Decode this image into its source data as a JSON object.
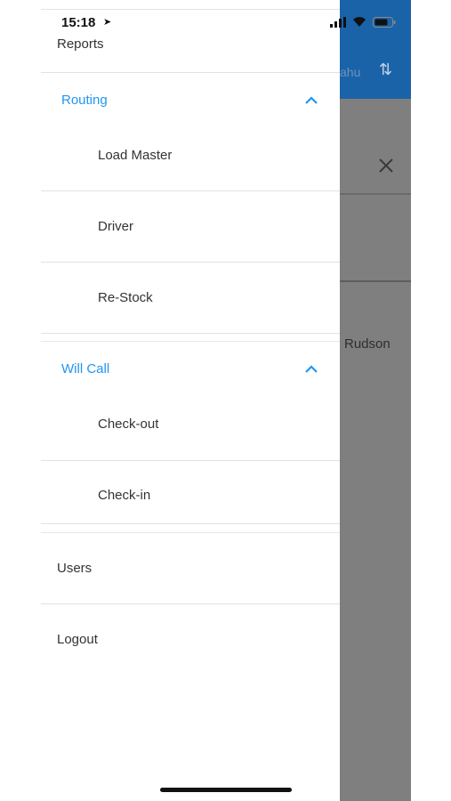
{
  "status_bar": {
    "time": "15:18",
    "location_icon": "location-arrow-icon",
    "icons": [
      "signal-icon",
      "wifi-icon",
      "battery-icon"
    ]
  },
  "background_screen": {
    "header_hint": "ahu",
    "sort_icon": "sort-arrows-icon",
    "close_icon": "close-icon",
    "visible_name": "Rudson",
    "accent_color": "#1a63a8"
  },
  "drawer": {
    "reports_label": "Reports",
    "routing": {
      "label": "Routing",
      "expanded": true,
      "items": [
        {
          "label": "Load Master"
        },
        {
          "label": "Driver"
        },
        {
          "label": "Re-Stock"
        }
      ]
    },
    "will_call": {
      "label": "Will Call",
      "expanded": true,
      "items": [
        {
          "label": "Check-out"
        },
        {
          "label": "Check-in"
        }
      ]
    },
    "users_label": "Users",
    "logout_label": "Logout",
    "accent_color": "#2196f3"
  }
}
